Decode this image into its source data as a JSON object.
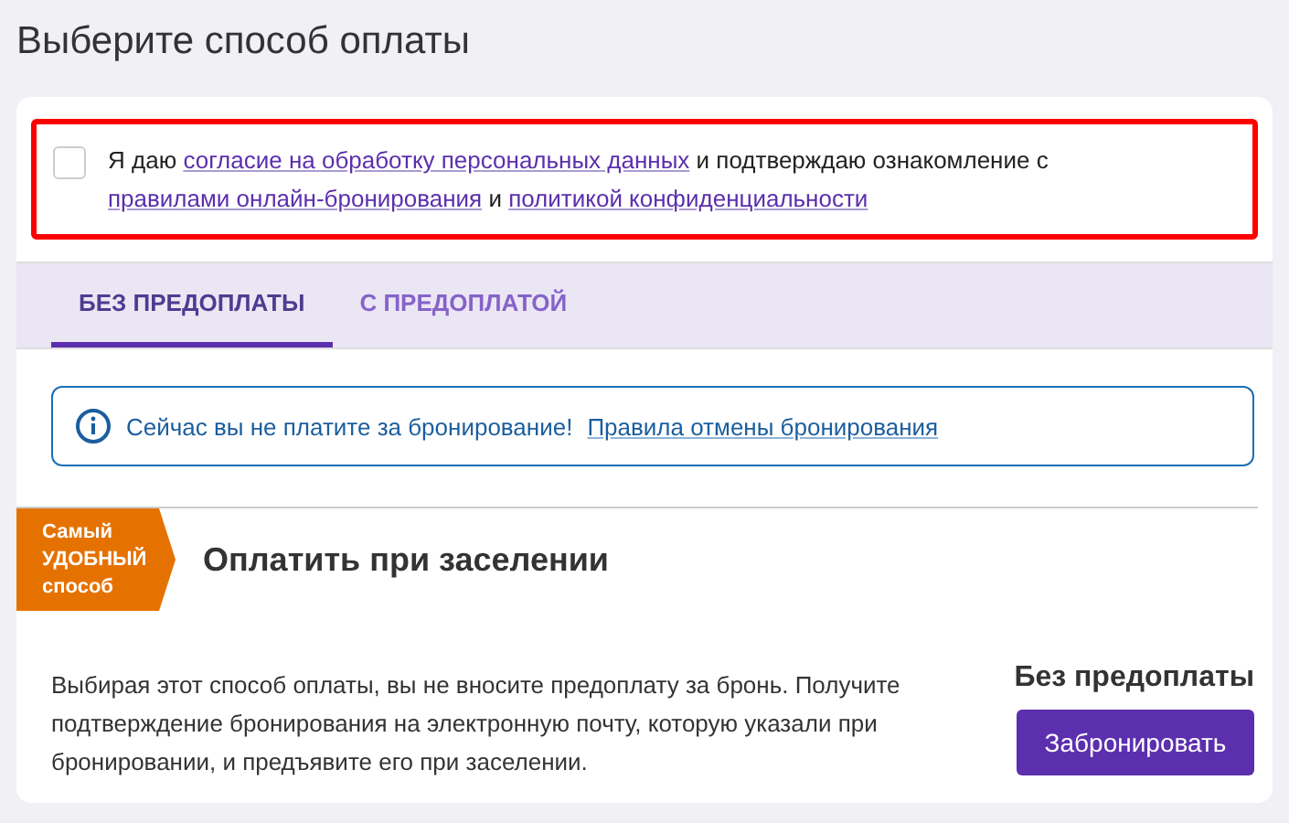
{
  "title": "Выберите способ оплаты",
  "consent": {
    "checked": false,
    "parts": [
      {
        "kind": "text",
        "text": "Я даю "
      },
      {
        "kind": "link",
        "text": "согласие на обработку персональных данных"
      },
      {
        "kind": "text",
        "text": " и подтверждаю ознакомление с "
      },
      {
        "kind": "link",
        "text": "правилами онлайн-бронирования"
      },
      {
        "kind": "text",
        "text": " и "
      },
      {
        "kind": "link",
        "text": "политикой конфиденциальности"
      }
    ]
  },
  "tabs": [
    {
      "label": "БЕЗ ПРЕДОПЛАТЫ",
      "selected": true
    },
    {
      "label": "С ПРЕДОПЛАТОЙ",
      "selected": false
    }
  ],
  "notice": {
    "text": "Сейчас вы не платите за бронирование!",
    "link": "Правила отмены бронирования"
  },
  "option": {
    "ribbon": [
      "Самый",
      "УДОБНЫЙ",
      "способ"
    ],
    "heading": "Оплатить при заселении",
    "description": "Выбирая этот способ оплаты, вы не вносите предоплату за бронь. Получите подтверждение бронирования на электронную почту, которую указали при бронировании, и предъявите его при заселении.",
    "price_label": "Без предоплаты",
    "button": "Забронировать"
  }
}
